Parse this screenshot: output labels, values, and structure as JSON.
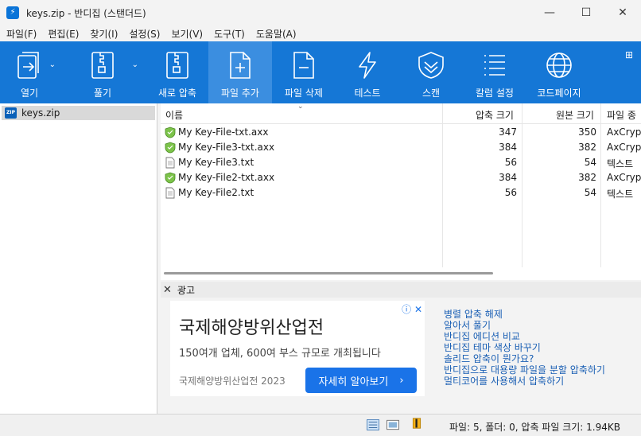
{
  "window": {
    "title": "keys.zip - 반디집 (스탠더드)",
    "controls": {
      "minimize": "—",
      "maximize": "☐",
      "close": "✕"
    }
  },
  "menu": [
    "파일(F)",
    "편집(E)",
    "찾기(I)",
    "설정(S)",
    "보기(V)",
    "도구(T)",
    "도움말(A)"
  ],
  "toolbar": {
    "open": "열기",
    "extract": "풀기",
    "new_archive": "새로 압축",
    "add_file": "파일 추가",
    "delete_file": "파일 삭제",
    "test": "테스트",
    "scan": "스캔",
    "column_settings": "칼럼 설정",
    "codepage": "코드페이지",
    "grid_icon": "⊞"
  },
  "tree": {
    "root": "keys.zip",
    "badge": "ZIP"
  },
  "filelist": {
    "headers": {
      "name": "이름",
      "packed": "압축 크기",
      "size": "원본 크기",
      "type": "파일 종"
    },
    "rows": [
      {
        "name": "My Key-File-txt.axx",
        "packed": "347",
        "size": "350",
        "type": "AxCrypt",
        "icon": "shield-icon"
      },
      {
        "name": "My Key-File3-txt.axx",
        "packed": "384",
        "size": "382",
        "type": "AxCrypt",
        "icon": "shield-icon"
      },
      {
        "name": "My Key-File3.txt",
        "packed": "56",
        "size": "54",
        "type": "텍스트",
        "icon": "text-file-icon"
      },
      {
        "name": "My Key-File2-txt.axx",
        "packed": "384",
        "size": "382",
        "type": "AxCrypt",
        "icon": "shield-icon"
      },
      {
        "name": "My Key-File2.txt",
        "packed": "56",
        "size": "54",
        "type": "텍스트",
        "icon": "text-file-icon"
      }
    ]
  },
  "ad": {
    "header": "광고",
    "headline": "국제해양방위산업전",
    "body": "150여개 업체, 600여 부스 규모로 개최됩니다",
    "brand": "국제해양방위산업전 2023",
    "cta": "자세히 알아보기",
    "links": [
      "병렬 압축 해제",
      "알아서 풀기",
      "반디집 에디션 비교",
      "반디집 테마 색상 바꾸기",
      "솔리드 압축이 뭔가요?",
      "반디집으로 대용량 파일을 분할 압축하기",
      "멀티코어를 사용해서 압축하기"
    ]
  },
  "status": {
    "text": "파일: 5, 폴더: 0, 압축 파일 크기: 1.94KB"
  },
  "colors": {
    "toolbar": "#1577d6",
    "toolbar_active": "#3b8ee0",
    "link": "#1a5fb4",
    "cta": "#1a73e8"
  }
}
